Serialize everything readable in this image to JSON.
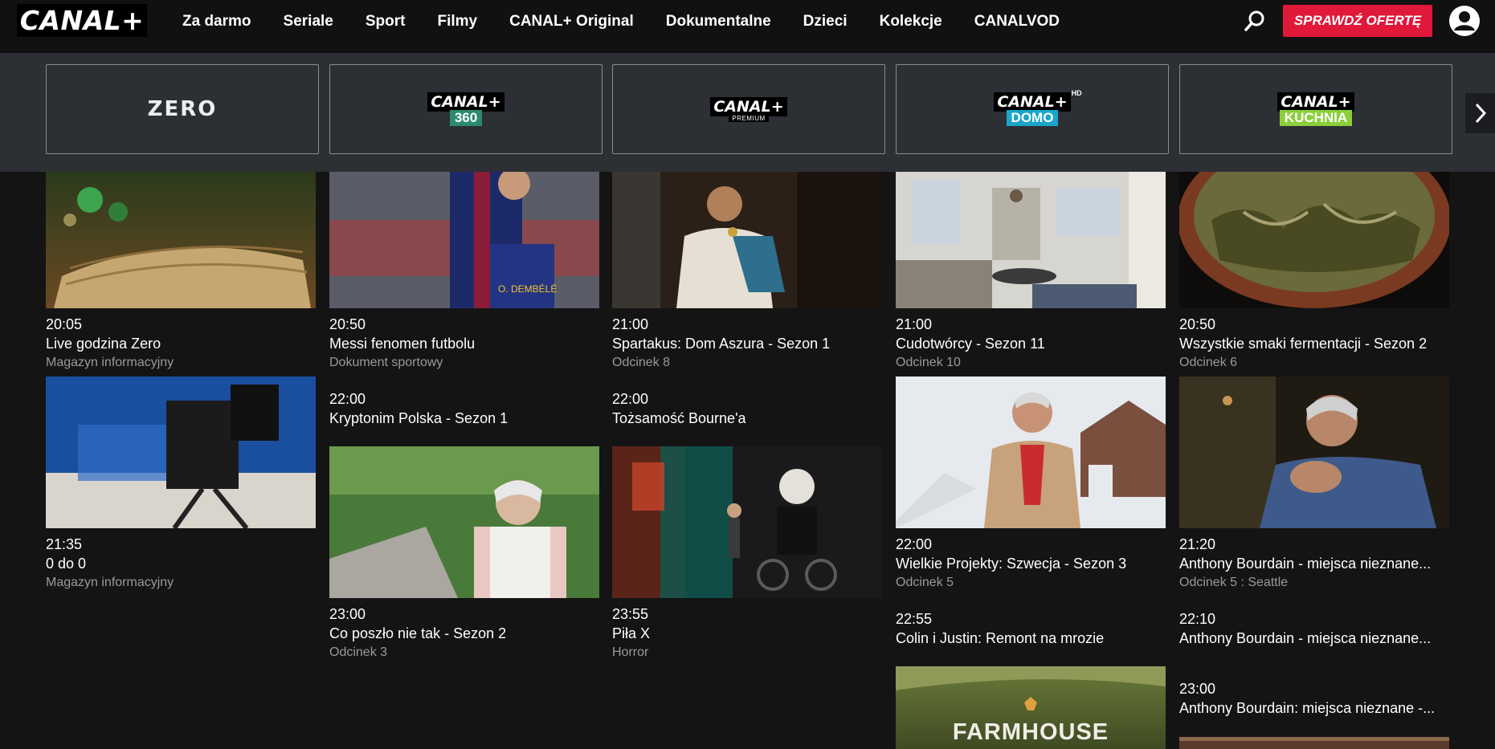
{
  "brand": {
    "logo_text": "CANAL+"
  },
  "nav": {
    "items": [
      "Za darmo",
      "Seriale",
      "Sport",
      "Filmy",
      "CANAL+ Original",
      "Dokumentalne",
      "Dzieci",
      "Kolekcje",
      "CANALVOD"
    ],
    "cta": "SPRAWDŹ OFERTĘ"
  },
  "channels": [
    {
      "name": "ZERO"
    },
    {
      "name": "CANAL+",
      "sub": "360"
    },
    {
      "name": "CANAL+",
      "sub": "PREMIUM"
    },
    {
      "name": "CANAL+",
      "sub": "DOMO",
      "badge": "HD"
    },
    {
      "name": "CANAL+",
      "sub": "KUCHNIA"
    }
  ],
  "schedule": {
    "col1": [
      {
        "time": "20:05",
        "title": "Live godzina Zero",
        "meta": "Magazyn informacyjny"
      },
      {
        "time": "21:35",
        "title": "0 do 0",
        "meta": "Magazyn informacyjny"
      }
    ],
    "col2": [
      {
        "time": "20:50",
        "title": "Messi fenomen futbolu",
        "meta": "Dokument sportowy"
      },
      {
        "time": "22:00",
        "title": "Kryptonim Polska - Sezon 1"
      },
      {
        "time": "23:00",
        "title": "Co poszło nie tak - Sezon 2",
        "meta": "Odcinek 3"
      }
    ],
    "col3": [
      {
        "time": "21:00",
        "title": "Spartakus: Dom Aszura - Sezon 1",
        "meta": "Odcinek 8"
      },
      {
        "time": "22:00",
        "title": "Tożsamość Bourne'a"
      },
      {
        "time": "23:55",
        "title": "Piła X",
        "meta": "Horror"
      }
    ],
    "col4": [
      {
        "time": "21:00",
        "title": "Cudotwórcy - Sezon 11",
        "meta": "Odcinek 10"
      },
      {
        "time": "22:00",
        "title": "Wielkie Projekty: Szwecja - Sezon 3",
        "meta": "Odcinek 5"
      },
      {
        "time": "22:55",
        "title": "Colin i Justin: Remont na mrozie"
      },
      {
        "thumb_text": "FARMHOUSE"
      }
    ],
    "col5": [
      {
        "time": "20:50",
        "title": "Wszystkie smaki fermentacji - Sezon 2",
        "meta": "Odcinek 6"
      },
      {
        "time": "21:20",
        "title": "Anthony Bourdain - miejsca nieznane...",
        "meta": "Odcinek 5 : Seattle"
      },
      {
        "time": "22:10",
        "title": "Anthony Bourdain - miejsca nieznane..."
      },
      {
        "time": "23:00",
        "title": "Anthony Bourdain: miejsca nieznane -..."
      }
    ]
  },
  "colors": {
    "accent": "#e0183a",
    "strip_bg": "#2c2f33",
    "page_bg": "#141414",
    "domo": "#1aa6c8",
    "kuchnia": "#8ccf3a",
    "c360": "#2c8a6e"
  }
}
